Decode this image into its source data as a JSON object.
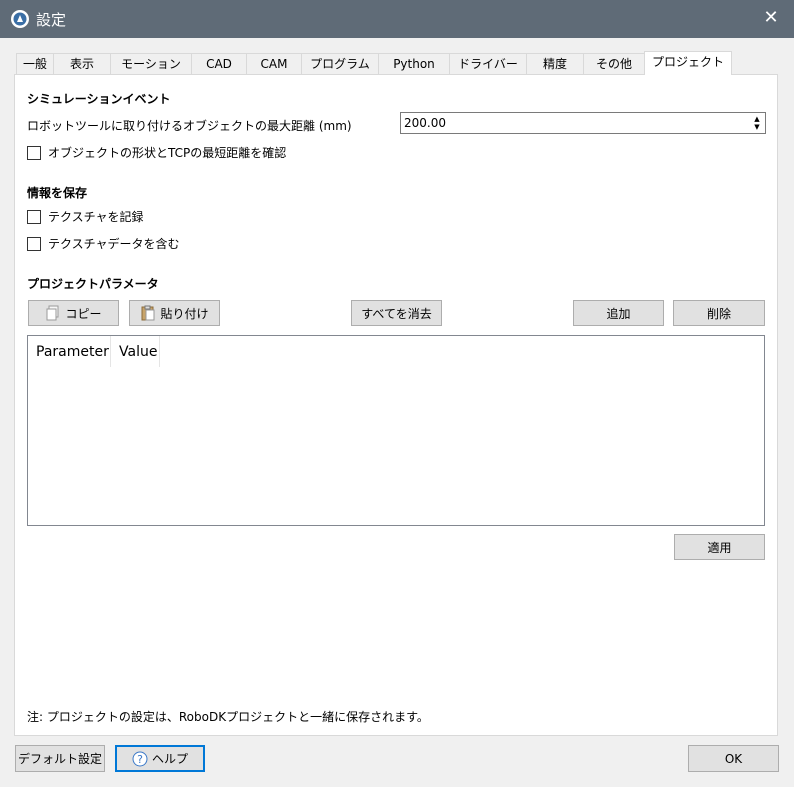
{
  "window": {
    "title": "設定",
    "close_glyph": "✕",
    "icon": "robodk-logo-icon"
  },
  "tabs": [
    {
      "label": "一般"
    },
    {
      "label": "表示"
    },
    {
      "label": "モーション"
    },
    {
      "label": "CAD"
    },
    {
      "label": "CAM"
    },
    {
      "label": "プログラム"
    },
    {
      "label": "Python"
    },
    {
      "label": "ドライバー"
    },
    {
      "label": "精度"
    },
    {
      "label": "その他"
    },
    {
      "label": "プロジェクト",
      "active": true
    }
  ],
  "simulation": {
    "title": "シミュレーションイベント",
    "max_distance_label": "ロボットツールに取り付けるオブジェクトの最大距離 (mm)",
    "max_distance_value": "200.00",
    "check_shape_label": "オブジェクトの形状とTCPの最短距離を確認",
    "check_shape_checked": false
  },
  "save_info": {
    "title": "情報を保存",
    "record_texture_label": "テクスチャを記録",
    "record_texture_checked": false,
    "include_texture_data_label": "テクスチャデータを含む",
    "include_texture_data_checked": false
  },
  "project_params": {
    "title": "プロジェクトパラメータ",
    "copy_label": "コピー",
    "paste_label": "貼り付け",
    "clear_all_label": "すべてを消去",
    "add_label": "追加",
    "delete_label": "削除",
    "columns": [
      "Parameter",
      "Value"
    ],
    "rows": [],
    "apply_label": "適用"
  },
  "note": "注: プロジェクトの設定は、RoboDKプロジェクトと一緒に保存されます。",
  "footer": {
    "default_label": "デフォルト設定",
    "help_label": "ヘルプ",
    "ok_label": "OK"
  }
}
